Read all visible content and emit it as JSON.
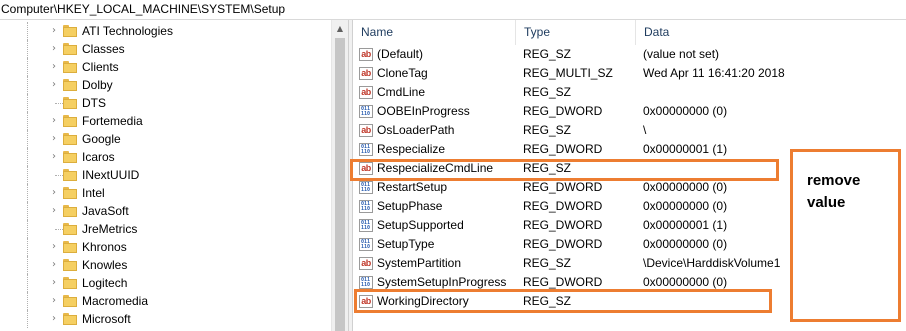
{
  "address": "Computer\\HKEY_LOCAL_MACHINE\\SYSTEM\\Setup",
  "tree": {
    "items": [
      {
        "label": "ATI Technologies",
        "expandable": true
      },
      {
        "label": "Classes",
        "expandable": true
      },
      {
        "label": "Clients",
        "expandable": true
      },
      {
        "label": "Dolby",
        "expandable": true
      },
      {
        "label": "DTS",
        "expandable": false
      },
      {
        "label": "Fortemedia",
        "expandable": true
      },
      {
        "label": "Google",
        "expandable": true
      },
      {
        "label": "Icaros",
        "expandable": true
      },
      {
        "label": "INextUUID",
        "expandable": false
      },
      {
        "label": "Intel",
        "expandable": true
      },
      {
        "label": "JavaSoft",
        "expandable": true
      },
      {
        "label": "JreMetrics",
        "expandable": false
      },
      {
        "label": "Khronos",
        "expandable": true
      },
      {
        "label": "Knowles",
        "expandable": true
      },
      {
        "label": "Logitech",
        "expandable": true
      },
      {
        "label": "Macromedia",
        "expandable": true
      },
      {
        "label": "Microsoft",
        "expandable": true
      }
    ]
  },
  "list": {
    "headers": {
      "name": "Name",
      "type": "Type",
      "data": "Data"
    },
    "rows": [
      {
        "icon": "string-value-icon",
        "name": "(Default)",
        "type": "REG_SZ",
        "data": "(value not set)"
      },
      {
        "icon": "string-value-icon",
        "name": "CloneTag",
        "type": "REG_MULTI_SZ",
        "data": "Wed Apr 11 16:41:20 2018"
      },
      {
        "icon": "string-value-icon",
        "name": "CmdLine",
        "type": "REG_SZ",
        "data": ""
      },
      {
        "icon": "binary-value-icon",
        "name": "OOBEInProgress",
        "type": "REG_DWORD",
        "data": "0x00000000 (0)"
      },
      {
        "icon": "string-value-icon",
        "name": "OsLoaderPath",
        "type": "REG_SZ",
        "data": "\\"
      },
      {
        "icon": "binary-value-icon",
        "name": "Respecialize",
        "type": "REG_DWORD",
        "data": "0x00000001 (1)"
      },
      {
        "icon": "string-value-icon",
        "name": "RespecializeCmdLine",
        "type": "REG_SZ",
        "data": ""
      },
      {
        "icon": "binary-value-icon",
        "name": "RestartSetup",
        "type": "REG_DWORD",
        "data": "0x00000000 (0)"
      },
      {
        "icon": "binary-value-icon",
        "name": "SetupPhase",
        "type": "REG_DWORD",
        "data": "0x00000000 (0)"
      },
      {
        "icon": "binary-value-icon",
        "name": "SetupSupported",
        "type": "REG_DWORD",
        "data": "0x00000001 (1)"
      },
      {
        "icon": "binary-value-icon",
        "name": "SetupType",
        "type": "REG_DWORD",
        "data": "0x00000000 (0)"
      },
      {
        "icon": "string-value-icon",
        "name": "SystemPartition",
        "type": "REG_SZ",
        "data": "\\Device\\HarddiskVolume1"
      },
      {
        "icon": "binary-value-icon",
        "name": "SystemSetupInProgress",
        "type": "REG_DWORD",
        "data": "0x00000000 (0)"
      },
      {
        "icon": "string-value-icon",
        "name": "WorkingDirectory",
        "type": "REG_SZ",
        "data": ""
      }
    ]
  },
  "icon_labels": {
    "string": "ab",
    "binary": "011\n110"
  },
  "annotation": {
    "note": "remove\nvalue",
    "color": "#ed7d31"
  }
}
